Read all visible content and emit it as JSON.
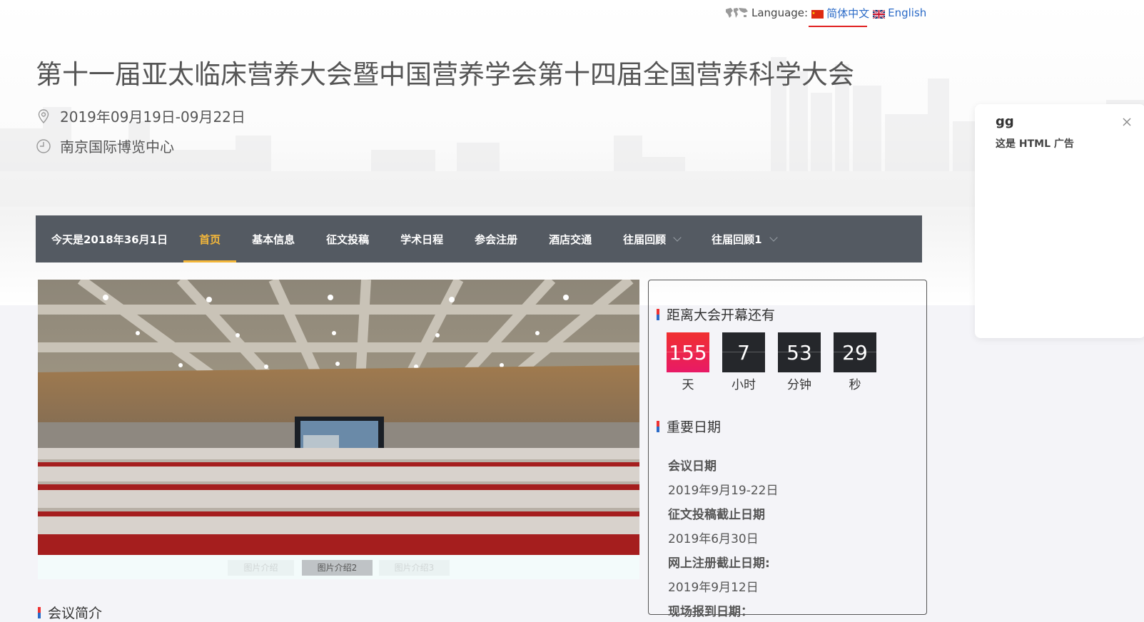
{
  "language": {
    "label": "Language:",
    "options": [
      "简体中文",
      "English"
    ],
    "active": "简体中文"
  },
  "header": {
    "title": "第十一届亚太临床营养大会暨中国营养学会第十四届全国营养科学大会",
    "date": "2019年09月19日-09月22日",
    "venue": "南京国际博览中心"
  },
  "nav": {
    "today": "今天是2018年36月1日",
    "items": [
      "首页",
      "基本信息",
      "征文投稿",
      "学术日程",
      "参会注册",
      "酒店交通",
      "往届回顾",
      "往届回顾1"
    ],
    "active": "首页"
  },
  "carousel": {
    "tabs": [
      "图片介绍",
      "图片介绍2",
      "图片介绍3"
    ],
    "active_tab": "图片介绍2"
  },
  "countdown": {
    "heading": "距离大会开幕还有",
    "days": "155",
    "days_label": "天",
    "hours": "7",
    "hours_label": "小时",
    "minutes": "53",
    "minutes_label": "分钟",
    "seconds": "29",
    "seconds_label": "秒"
  },
  "important_dates": {
    "heading": "重要日期",
    "items": [
      {
        "label": "会议日期",
        "value": "2019年9月19-22日"
      },
      {
        "label": "征文投稿截止日期",
        "value": "2019年6月30日"
      },
      {
        "label": "网上注册截止日期:",
        "value": "2019年9月12日"
      },
      {
        "label": "现场报到日期："
      }
    ]
  },
  "ad": {
    "title": "gg",
    "body": "这是 HTML 广告"
  },
  "section_intro": {
    "heading": "会议简介"
  },
  "colors": {
    "nav_bg": "#545a62",
    "nav_active": "#f3b73a",
    "countdown_accent": "#e81a66",
    "link_blue": "#2a6ac7",
    "underline_red": "#e02020"
  }
}
